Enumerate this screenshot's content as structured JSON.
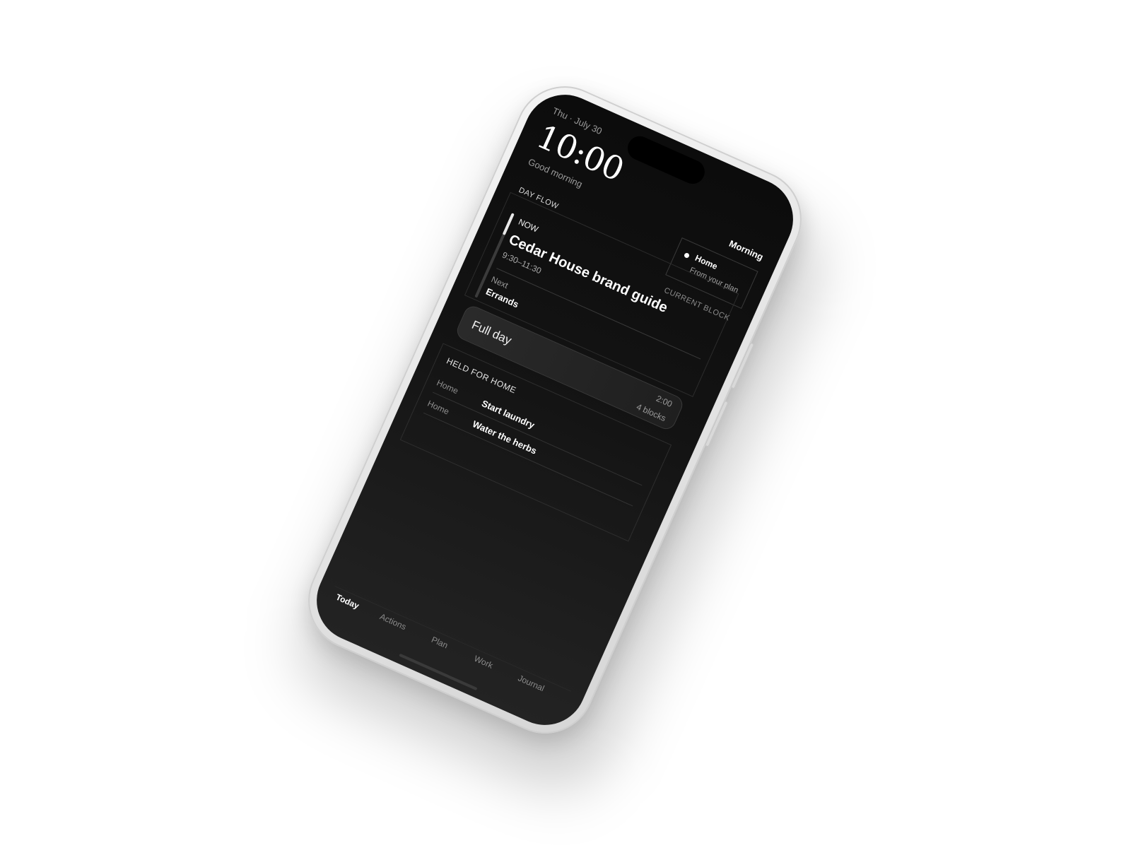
{
  "status": {
    "date": "Thu · July 30"
  },
  "header": {
    "time": "10:00",
    "greeting": "Good morning",
    "period": "Morning"
  },
  "location_card": {
    "title": "Home",
    "subtitle": "From your plan"
  },
  "day_flow": {
    "label": "DAY FLOW",
    "now_label": "NOW",
    "current_label": "CURRENT BLOCK",
    "current_title": "Cedar House brand guide",
    "current_time": "9:30–11:30",
    "progress": 0.25,
    "next_label": "Next",
    "next_value": "Errands"
  },
  "full_day": {
    "label": "Full day",
    "duration": "2:00",
    "blocks": "4 blocks"
  },
  "held": {
    "title": "HELD FOR HOME",
    "items": [
      {
        "category": "Home",
        "task": "Start laundry"
      },
      {
        "category": "Home",
        "task": "Water the herbs"
      }
    ]
  },
  "tabs": [
    {
      "label": "Today",
      "active": true
    },
    {
      "label": "Actions",
      "active": false
    },
    {
      "label": "Plan",
      "active": false
    },
    {
      "label": "Work",
      "active": false
    },
    {
      "label": "Journal",
      "active": false
    }
  ]
}
